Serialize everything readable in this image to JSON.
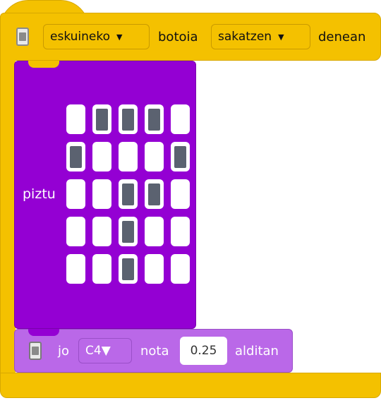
{
  "colors": {
    "event_block": "#F4C100",
    "led_block": "#9400D3",
    "sound_block": "#BA68E8",
    "led_on": "#5b6270",
    "led_off": "#ffffff"
  },
  "event_block": {
    "icon": "microbit-device-icon",
    "button_dropdown": "eskuineko",
    "label_button": "botoia",
    "action_dropdown": "sakatzen",
    "label_when": "denean"
  },
  "led_block": {
    "label": "piztu",
    "grid": [
      [
        0,
        1,
        1,
        1,
        0
      ],
      [
        1,
        0,
        0,
        0,
        1
      ],
      [
        0,
        0,
        1,
        1,
        0
      ],
      [
        0,
        0,
        1,
        0,
        0
      ],
      [
        0,
        0,
        1,
        0,
        0
      ]
    ]
  },
  "sound_block": {
    "icon": "microbit-device-icon",
    "label_play": "jo",
    "note_dropdown": "C4",
    "label_note": "nota",
    "beats_value": "0.25",
    "label_beats": "alditan"
  }
}
